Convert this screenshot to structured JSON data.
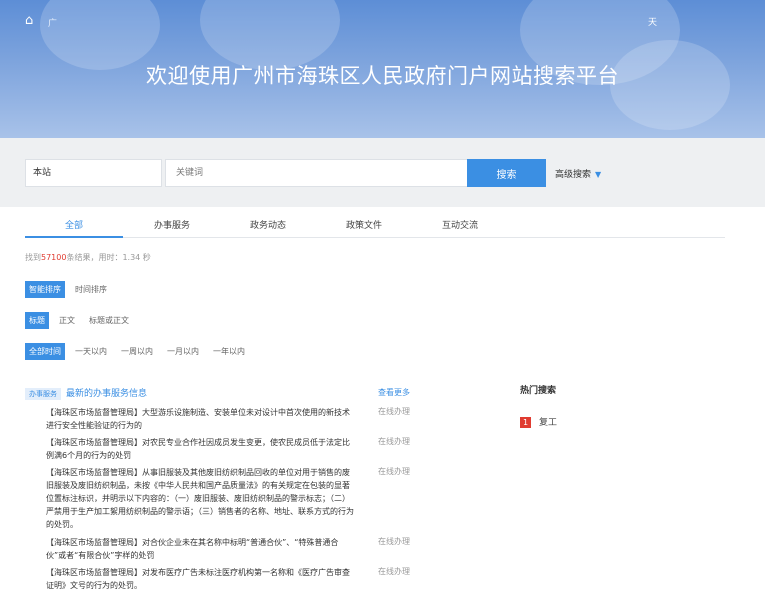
{
  "banner": {
    "nav_text": "广",
    "right_text": "天",
    "title": "欢迎使用广州市海珠区人民政府门户网站搜索平台"
  },
  "search": {
    "scope": "本站",
    "placeholder": "关键词",
    "button": "搜索",
    "advanced": "高级搜索"
  },
  "tabs": [
    "全部",
    "办事服务",
    "政务动态",
    "政策文件",
    "互动交流"
  ],
  "stats": {
    "prefix": "找到",
    "count": "57100",
    "suffix": "条结果，用时：1.34 秒"
  },
  "filters": {
    "sort": [
      "智能排序",
      "时间排序"
    ],
    "field": [
      "标题",
      "正文",
      "标题或正文"
    ],
    "time": [
      "全部时间",
      "一天以内",
      "一周以内",
      "一月以内",
      "一年以内"
    ]
  },
  "section": {
    "tag": "办事服务",
    "title": "最新的办事服务信息",
    "more": "查看更多"
  },
  "items": [
    {
      "text": "【海珠区市场监督管理局】大型游乐设施制造、安装单位未对设计中首次使用的新技术进行安全性能验证的行为的",
      "action": "在线办理"
    },
    {
      "text": "【海珠区市场监督管理局】对农民专业合作社因成员发生变更，使农民成员低于法定比例满6个月的行为的处罚",
      "action": "在线办理"
    },
    {
      "text": "【海珠区市场监督管理局】从事旧服装及其他废旧纺织制品回收的单位对用于销售的废旧服装及废旧纺织制品，未按《中华人民共和国产品质量法》的有关规定在包装的显著位置标注标识，并明示以下内容的：（一）废旧服装、废旧纺织制品的警示标志；（二）严禁用于生产加工絮用纺织制品的警示语；（三）销售者的名称、地址、联系方式的行为的处罚。",
      "action": "在线办理"
    },
    {
      "text": "【海珠区市场监督管理局】对合伙企业未在其名称中标明“普通合伙”、“特殊普通合伙”或者“有限合伙”字样的处罚",
      "action": "在线办理"
    },
    {
      "text": "【海珠区市场监督管理局】对发布医疗广告未标注医疗机构第一名称和《医疗广告审查证明》文号的行为的处罚。",
      "action": "在线办理"
    }
  ],
  "hot": {
    "title": "热门搜索",
    "items": [
      {
        "rank": "1",
        "text": "复工"
      }
    ]
  }
}
